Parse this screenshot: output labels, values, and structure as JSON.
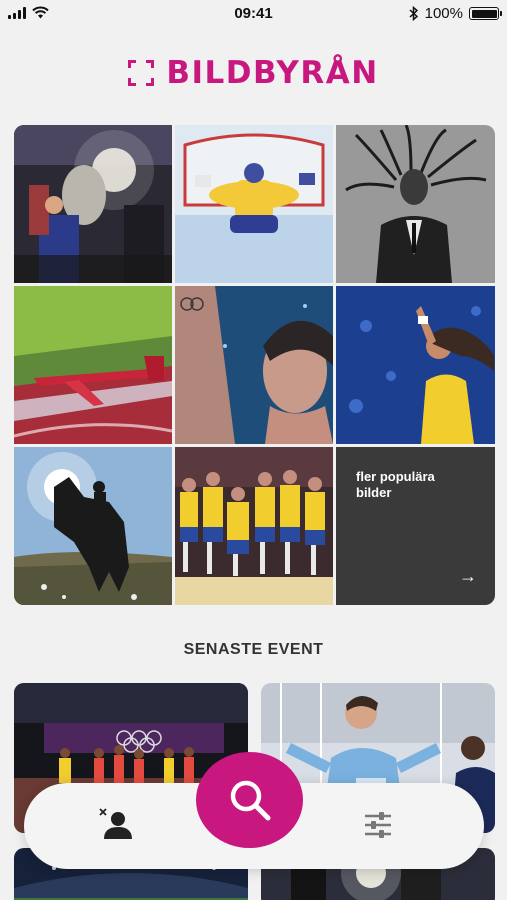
{
  "status_bar": {
    "time": "09:41",
    "battery_text": "100%",
    "battery_level": 1.0,
    "icons": [
      "signal-icon",
      "wifi-icon",
      "bluetooth-icon",
      "battery-icon"
    ]
  },
  "brand": {
    "name": "BILDBYRÅN",
    "color": "#c8187f"
  },
  "popular": {
    "photos": [
      "trophy-celebration-photo",
      "hockey-goalie-photo",
      "dreadlocks-portrait-photo",
      "aerobatic-plane-photo",
      "swimmer-portrait-photo",
      "footballer-celebration-photo",
      "equestrian-rider-photo",
      "handball-team-photo"
    ],
    "more_label": "fler populära bilder",
    "more_arrow": "→"
  },
  "events": {
    "title": "SENASTE EVENT",
    "cards": [
      "olympic-track-event",
      "football-celebration-event",
      "stadium-event",
      "night-event"
    ]
  },
  "toolbar": {
    "icons": [
      "profile-icon",
      "search-icon",
      "filter-icon"
    ],
    "accent": "#c8187f"
  }
}
